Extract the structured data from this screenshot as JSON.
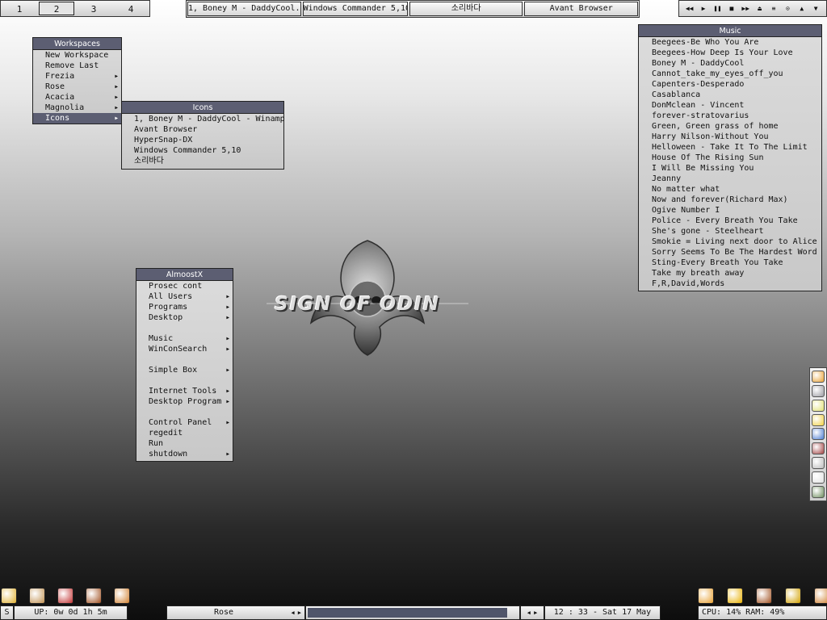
{
  "pager": {
    "workspaces": [
      "1",
      "2",
      "3",
      "4"
    ],
    "active_index": 1
  },
  "taskbar": {
    "tasks": [
      "1, Boney M - DaddyCool...",
      "Windows Commander 5,10",
      "소리바다",
      "Avant Browser"
    ]
  },
  "player": {
    "controls": [
      "rewind-icon",
      "play-icon",
      "pause-icon",
      "stop-icon",
      "forward-icon",
      "eject-icon",
      "playlist-icon",
      "settings-icon",
      "up-icon",
      "down-icon"
    ]
  },
  "workspaces_menu": {
    "title": "Workspaces",
    "items": [
      {
        "label": "New Workspace",
        "submenu": false
      },
      {
        "label": "Remove Last",
        "submenu": false
      },
      {
        "label": "Frezia",
        "submenu": true
      },
      {
        "label": "Rose",
        "submenu": true
      },
      {
        "label": "Acacia",
        "submenu": true
      },
      {
        "label": "Magnolia",
        "submenu": true
      },
      {
        "label": "Icons",
        "submenu": true,
        "selected": true
      }
    ]
  },
  "icons_menu": {
    "title": "Icons",
    "items": [
      "1, Boney M - DaddyCool - Winamp",
      "Avant Browser",
      "HyperSnap-DX",
      "Windows Commander 5,10",
      "소리바다"
    ]
  },
  "almost_menu": {
    "title": "AlmoostX",
    "items": [
      {
        "label": "Prosec cont",
        "submenu": false
      },
      {
        "label": "All Users",
        "submenu": true
      },
      {
        "label": "Programs",
        "submenu": true
      },
      {
        "label": "Desktop",
        "submenu": true
      },
      {
        "label": "",
        "gap": true
      },
      {
        "label": "Music",
        "submenu": true
      },
      {
        "label": "WinConSearch",
        "submenu": true
      },
      {
        "label": "",
        "gap": true
      },
      {
        "label": "Simple Box",
        "submenu": true
      },
      {
        "label": "",
        "gap": true
      },
      {
        "label": "Internet Tools",
        "submenu": true
      },
      {
        "label": "Desktop Program",
        "submenu": true
      },
      {
        "label": "",
        "gap": true
      },
      {
        "label": "Control Panel",
        "submenu": true
      },
      {
        "label": "regedit",
        "submenu": false
      },
      {
        "label": "Run",
        "submenu": false
      },
      {
        "label": "shutdown",
        "submenu": true
      }
    ]
  },
  "music_menu": {
    "title": "Music",
    "items": [
      "Beegees-Be Who You Are",
      "Beegees-How Deep Is Your Love",
      "Boney M - DaddyCool",
      "Cannot_take_my_eyes_off_you",
      "Capenters-Desperado",
      "Casablanca",
      "DonMclean - Vincent",
      "forever-stratovarius",
      "Green, Green grass of home",
      "Harry Nilson-Without You",
      "Helloween - Take It To The Limit",
      "House Of The Rising Sun",
      "I Will Be Missing You",
      "Jeanny",
      "No matter what",
      "Now and forever(Richard Max)",
      "Ogive Number I",
      "Police - Every Breath You Take",
      "She's gone - Steelheart",
      "Smokie = Living next door to Alice",
      "Sorry Seems To Be The Hardest Word",
      "Sting-Every Breath You Take",
      "Take my breath away",
      "F,R,David,Words"
    ]
  },
  "logo": {
    "text": "SIGN OF ODIN"
  },
  "dock": {
    "icons": [
      "flower-icon",
      "computer-icon",
      "note-icon",
      "folder-icon",
      "network-icon",
      "tools-icon",
      "printer-icon",
      "bulb-icon",
      "korean-input-icon"
    ]
  },
  "launchers": {
    "left": [
      "pie-icon",
      "home-icon",
      "apple-icon",
      "book-icon",
      "paint-icon"
    ],
    "right": [
      "flower-icon",
      "star-icon",
      "book-icon",
      "gold-icon",
      "paint-icon"
    ]
  },
  "status": {
    "screen_label": "S",
    "uptime": "UP: 0w 0d 1h 5m",
    "workspace": "Rose",
    "clock": "12 : 33  -  Sat 17 May",
    "cpu_ram": "CPU: 14% RAM: 49%",
    "progress": 0.95
  }
}
